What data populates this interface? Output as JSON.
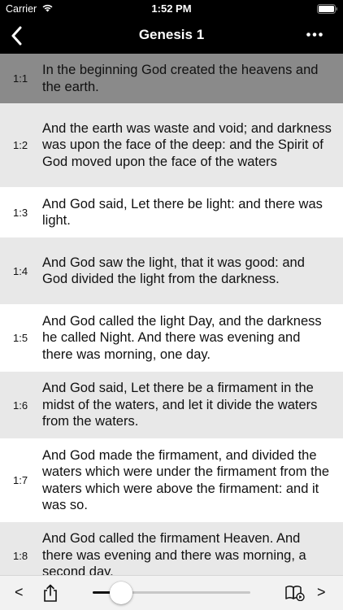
{
  "status_bar": {
    "carrier": "Carrier",
    "time": "1:52 PM"
  },
  "nav": {
    "title": "Genesis 1",
    "back_icon": "chevron-left-icon",
    "more_icon": "ellipsis-icon"
  },
  "verses": [
    {
      "num": "1:1",
      "text": "In the beginning God created the heavens and the earth.",
      "selected": true
    },
    {
      "num": "1:2",
      "text": "And the earth was waste and void; and darkness was upon the face of the deep: and the Spirit of God moved upon the face of the waters"
    },
    {
      "num": "1:3",
      "text": "And God said, Let there be light: and there was light."
    },
    {
      "num": "1:4",
      "text": "And God saw the light, that it was good: and God divided the light from the darkness."
    },
    {
      "num": "1:5",
      "text": "And God called the light Day, and the darkness he called Night. And there was evening and there was morning, one day."
    },
    {
      "num": "1:6",
      "text": "And God said, Let there be a firmament in the midst of the waters, and let it divide the waters from the waters."
    },
    {
      "num": "1:7",
      "text": "And God made the firmament, and divided the waters which were under the firmament from the waters which were above the firmament: and it was so."
    },
    {
      "num": "1:8",
      "text": "And God called the firmament Heaven. And there was evening and there was morning, a second day."
    }
  ],
  "toolbar": {
    "prev_label": "<",
    "next_label": ">",
    "slider_fraction": 0.18
  },
  "colors": {
    "selected_row": "#8a8a8a",
    "alt_row": "#e8e8e8",
    "nav_bg": "#000000"
  }
}
